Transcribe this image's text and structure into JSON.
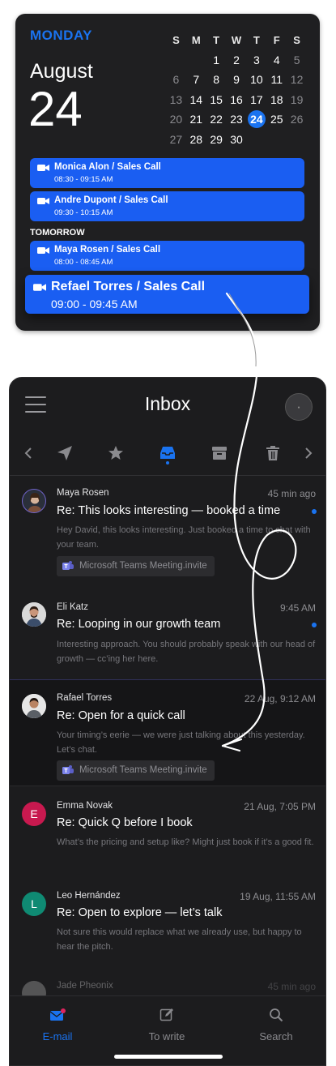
{
  "calendar": {
    "day_name": "MONDAY",
    "month": "August",
    "date": "24",
    "weekdays": [
      "S",
      "M",
      "T",
      "W",
      "T",
      "F",
      "S"
    ],
    "weeks": [
      [
        {
          "d": "",
          "t": ""
        },
        {
          "d": "",
          "t": ""
        },
        {
          "d": "1",
          "t": ""
        },
        {
          "d": "2",
          "t": ""
        },
        {
          "d": "3",
          "t": ""
        },
        {
          "d": "4",
          "t": ""
        },
        {
          "d": "5",
          "t": "dim"
        }
      ],
      [
        {
          "d": "6",
          "t": "dim"
        },
        {
          "d": "7",
          "t": ""
        },
        {
          "d": "8",
          "t": ""
        },
        {
          "d": "9",
          "t": ""
        },
        {
          "d": "10",
          "t": ""
        },
        {
          "d": "11",
          "t": ""
        },
        {
          "d": "12",
          "t": "dim"
        }
      ],
      [
        {
          "d": "13",
          "t": "dim"
        },
        {
          "d": "14",
          "t": ""
        },
        {
          "d": "15",
          "t": ""
        },
        {
          "d": "16",
          "t": ""
        },
        {
          "d": "17",
          "t": ""
        },
        {
          "d": "18",
          "t": ""
        },
        {
          "d": "19",
          "t": "dim"
        }
      ],
      [
        {
          "d": "20",
          "t": "dim"
        },
        {
          "d": "21",
          "t": ""
        },
        {
          "d": "22",
          "t": ""
        },
        {
          "d": "23",
          "t": ""
        },
        {
          "d": "24",
          "t": "sel"
        },
        {
          "d": "25",
          "t": ""
        },
        {
          "d": "26",
          "t": "dim"
        }
      ],
      [
        {
          "d": "27",
          "t": "dim"
        },
        {
          "d": "28",
          "t": ""
        },
        {
          "d": "29",
          "t": ""
        },
        {
          "d": "30",
          "t": ""
        },
        {
          "d": "",
          "t": ""
        },
        {
          "d": "",
          "t": ""
        },
        {
          "d": "",
          "t": ""
        }
      ]
    ],
    "events_today": [
      {
        "title": "Monica Alon / Sales Call",
        "time": "08:30 - 09:15 AM"
      },
      {
        "title": "Andre Dupont / Sales Call",
        "time": "09:30 - 10:15 AM"
      }
    ],
    "tomorrow_label": "TOMORROW",
    "events_tomorrow": [
      {
        "title": "Maya Rosen / Sales Call",
        "time": "08:00 - 08:45 AM"
      }
    ],
    "dragged_event": {
      "title": "Refael Torres / Sales Call",
      "time": "09:00 - 09:45 AM"
    },
    "accent_color": "#1a73f0",
    "event_color": "#1a5ef2"
  },
  "inbox": {
    "title": "Inbox",
    "toolbar_icons": [
      "chevron-left-icon",
      "send-icon",
      "star-icon",
      "inbox-icon",
      "archive-icon",
      "trash-icon",
      "chevron-right-icon"
    ],
    "messages": [
      {
        "sender": "Maya Rosen",
        "time": "45 min ago",
        "subject": "Re: This looks interesting — booked a time",
        "preview": "Hey David, this looks interesting. Just booked a time to chat with your team.",
        "attachment": "Microsoft Teams Meeting.invite",
        "unread": true
      },
      {
        "sender": "Eli Katz",
        "time": "9:45 AM",
        "subject": "Re: Looping in our growth team",
        "preview": "Interesting approach. You should probably speak with our head of growth — cc’ing her here.",
        "unread": true
      },
      {
        "sender": "Rafael Torres",
        "time": "22 Aug, 9:12 AM",
        "subject": "Re: Open for a quick call",
        "preview": "Your timing’s eerie — we were just talking about this yesterday. Let’s chat.",
        "attachment": "Microsoft Teams Meeting.invite"
      },
      {
        "sender": "Emma Novak",
        "initial": "E",
        "avatar_color": "#c8194f",
        "time": "21 Aug, 7:05 PM",
        "subject": "Re: Quick Q before I book",
        "preview": "What’s the pricing and setup like? Might just book if it’s a good fit."
      },
      {
        "sender": "Leo Hernández",
        "initial": "L",
        "avatar_color": "#0f8a73",
        "time": "19 Aug, 11:55 AM",
        "subject": "Re: Open to explore — let’s talk",
        "preview": "Not sure this would replace what we already use, but happy to hear the pitch."
      },
      {
        "sender": "Jade Pheonix",
        "time": "45 min ago"
      }
    ]
  },
  "bottom_nav": {
    "items": [
      {
        "label": "E-mail",
        "icon": "mail-icon",
        "active": true
      },
      {
        "label": "To write",
        "icon": "compose-icon"
      },
      {
        "label": "Search",
        "icon": "search-icon"
      }
    ]
  }
}
